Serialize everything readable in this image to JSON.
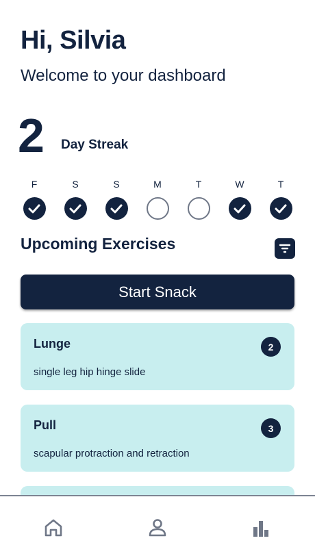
{
  "header": {
    "greeting": "Hi, Silvia",
    "welcome": "Welcome to your dashboard"
  },
  "streak": {
    "count": "2",
    "label": "Day Streak"
  },
  "week": [
    {
      "letter": "F",
      "completed": true
    },
    {
      "letter": "S",
      "completed": true
    },
    {
      "letter": "S",
      "completed": true
    },
    {
      "letter": "M",
      "completed": false
    },
    {
      "letter": "T",
      "completed": false
    },
    {
      "letter": "W",
      "completed": true
    },
    {
      "letter": "T",
      "completed": true
    }
  ],
  "exercises": {
    "title": "Upcoming Exercises",
    "filter_icon": "filter-icon",
    "start_label": "Start Snack",
    "items": [
      {
        "title": "Lunge",
        "subtitle": "single leg hip hinge slide",
        "badge": "2"
      },
      {
        "title": "Pull",
        "subtitle": "scapular protraction and retraction",
        "badge": "3"
      }
    ]
  },
  "nav": {
    "items": [
      "home-icon",
      "profile-icon",
      "stats-icon"
    ]
  },
  "colors": {
    "primary": "#13233f",
    "card": "#c8eeef",
    "muted": "#6f7787"
  }
}
